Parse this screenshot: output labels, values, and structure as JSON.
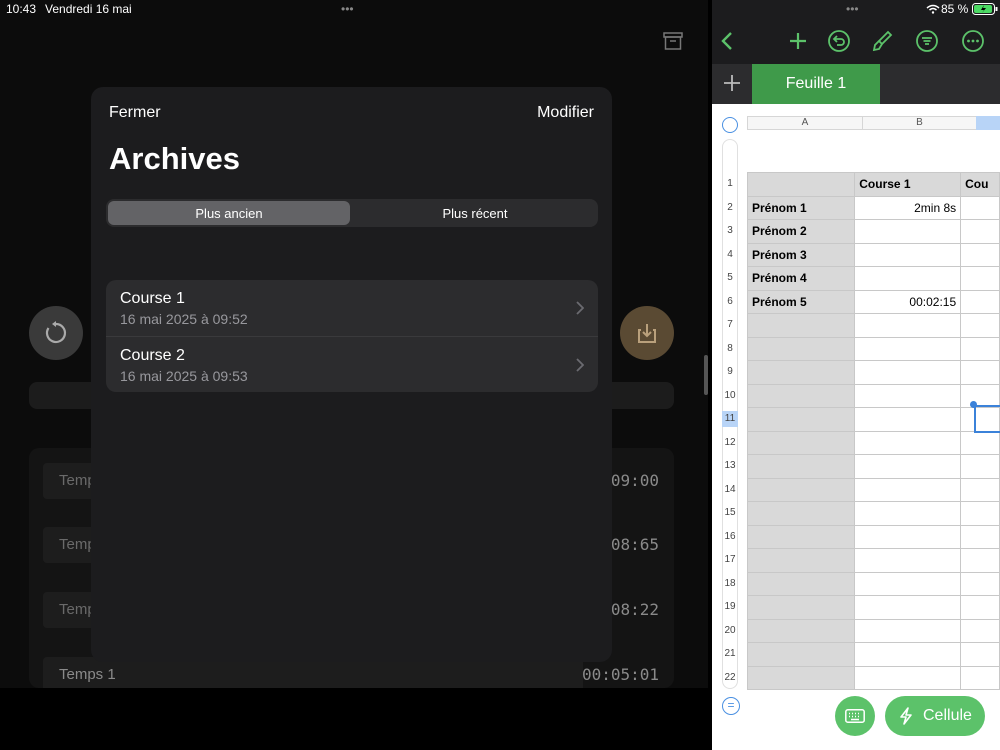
{
  "left_status": {
    "time": "10:43",
    "date": "Vendredi 16 mai",
    "dots": "•••"
  },
  "right_status": {
    "dots": "•••",
    "battery": "85 %"
  },
  "archives_sheet": {
    "close_label": "Fermer",
    "edit_label": "Modifier",
    "title": "Archives",
    "segments": [
      "Plus ancien",
      "Plus récent"
    ],
    "selected_segment": "Plus ancien",
    "items": [
      {
        "title": "Course 1",
        "date": "16 mai 2025 à 09:52"
      },
      {
        "title": "Course 2",
        "date": "16 mai 2025 à 09:53"
      }
    ]
  },
  "background_app": {
    "times": [
      {
        "label": "Temps",
        "value": "09:00"
      },
      {
        "label": "Temps",
        "value": "08:65"
      },
      {
        "label": "Temps",
        "value": "08:22"
      },
      {
        "label": "Temps 1",
        "value": "00:05:01"
      }
    ]
  },
  "numbers": {
    "sheet_tab": "Feuille 1",
    "column_headers": [
      "A",
      "B"
    ],
    "row_numbers": [
      "1",
      "2",
      "3",
      "4",
      "5",
      "6",
      "7",
      "8",
      "9",
      "10",
      "11",
      "12",
      "13",
      "14",
      "15",
      "16",
      "17",
      "18",
      "19",
      "20",
      "21",
      "22"
    ],
    "active_row": "11",
    "header_row": [
      "",
      "Course 1",
      "Cou"
    ],
    "rows": [
      [
        "Prénom 1",
        "2min 8s",
        ""
      ],
      [
        "Prénom 2",
        "",
        ""
      ],
      [
        "Prénom 3",
        "",
        ""
      ],
      [
        "Prénom 4",
        "",
        ""
      ],
      [
        "Prénom 5",
        "00:02:15",
        ""
      ]
    ],
    "cell_button": "Cellule",
    "formula_symbol": "="
  },
  "colors": {
    "accent_green": "#5cc26a",
    "tab_green": "#3f9a4a",
    "selection_blue": "#3b82d9"
  }
}
